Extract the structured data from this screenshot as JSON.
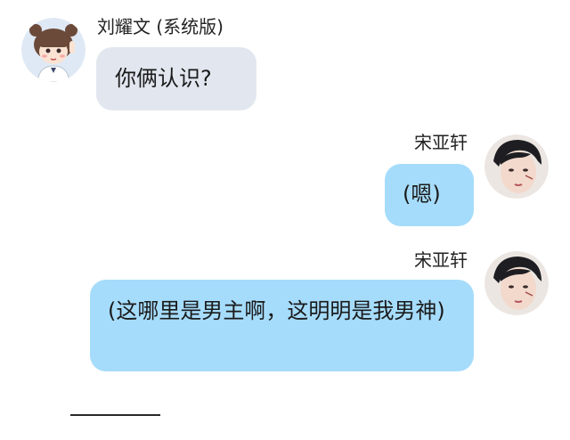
{
  "messages": [
    {
      "sender": "刘耀文 (系统版)",
      "text": "你俩认识?",
      "side": "left",
      "avatar_icon": "cartoon-girl-avatar-icon"
    },
    {
      "sender": "宋亚轩",
      "text": "(嗯)",
      "side": "right",
      "avatar_icon": "boy-portrait-avatar-icon"
    },
    {
      "sender": "宋亚轩",
      "text": "(这哪里是男主啊，这明明是我男神)",
      "side": "right",
      "avatar_icon": "boy-portrait-avatar-icon"
    }
  ],
  "colors": {
    "left_bubble": "#e2e7ef",
    "right_bubble": "#a6dcfb",
    "background": "#ffffff"
  }
}
